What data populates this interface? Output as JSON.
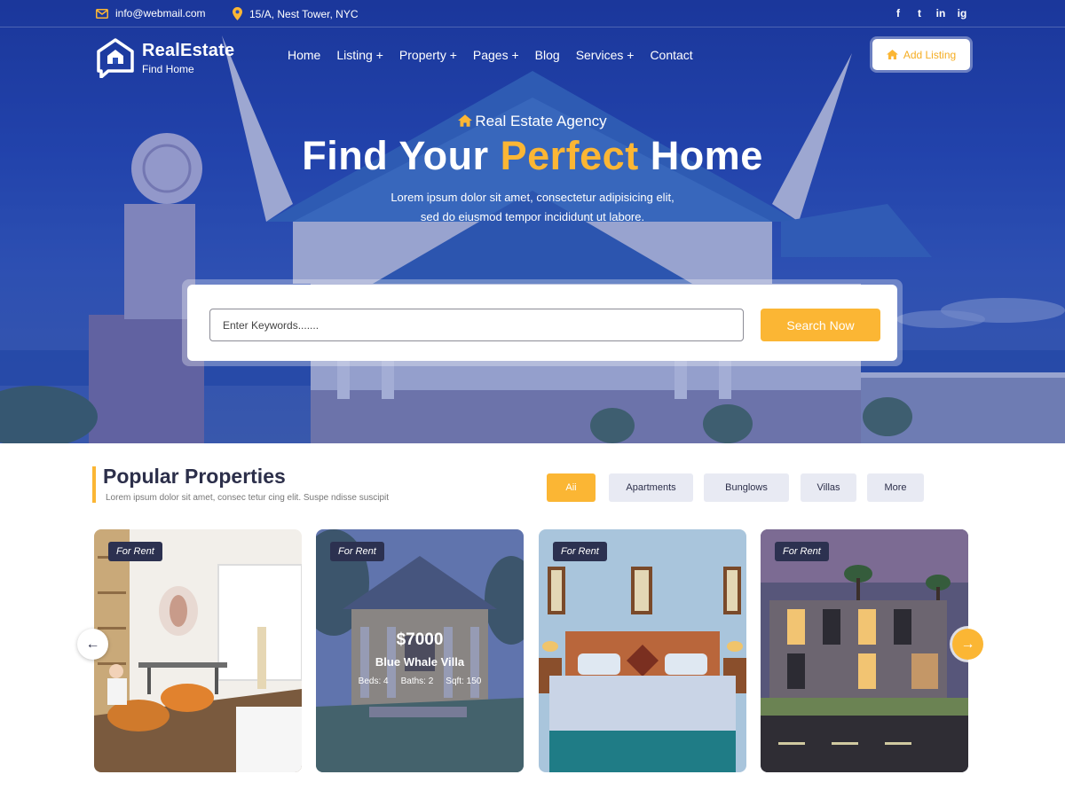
{
  "topbar": {
    "email": "info@webmail.com",
    "address": "15/A, Nest Tower, NYC",
    "social": [
      "f",
      "t",
      "in",
      "ig"
    ]
  },
  "brand": {
    "name": "RealEstate",
    "tagline": "Find Home"
  },
  "nav": {
    "items": [
      "Home",
      "Listing +",
      "Property +",
      "Pages +",
      "Blog",
      "Services +",
      "Contact"
    ],
    "add_listing": "Add Listing"
  },
  "hero": {
    "kicker": "Real Estate Agency",
    "headline_start": "Find Your ",
    "headline_accent": "Perfect",
    "headline_end": " Home",
    "subline_1": "Lorem ipsum dolor sit amet, consectetur adipisicing elit,",
    "subline_2": "sed do eiusmod tempor incididunt ut labore."
  },
  "search": {
    "placeholder": "Enter Keywords.......",
    "button": "Search Now"
  },
  "properties": {
    "title": "Popular Properties",
    "subtitle": "Lorem ipsum dolor sit amet, consec tetur cing elit. Suspe ndisse suscipit",
    "filters": [
      "Aii",
      "Apartments",
      "Bunglows",
      "Villas",
      "More"
    ],
    "active_filter": "Aii",
    "cards": [
      {
        "tag": "For Rent"
      },
      {
        "tag": "For Rent",
        "price": "$7000",
        "name": "Blue Whale Villa",
        "beds": "Beds: 4",
        "baths": "Baths: 2",
        "sqft": "Sqft: 150"
      },
      {
        "tag": "For Rent"
      },
      {
        "tag": "For Rent"
      }
    ],
    "prev_arrow": "←",
    "next_arrow": "→"
  },
  "colors": {
    "accent": "#fbb634",
    "brand_blue": "#2a4fb8",
    "heading": "#2c2f4a",
    "tag_bg": "#2c3150"
  }
}
